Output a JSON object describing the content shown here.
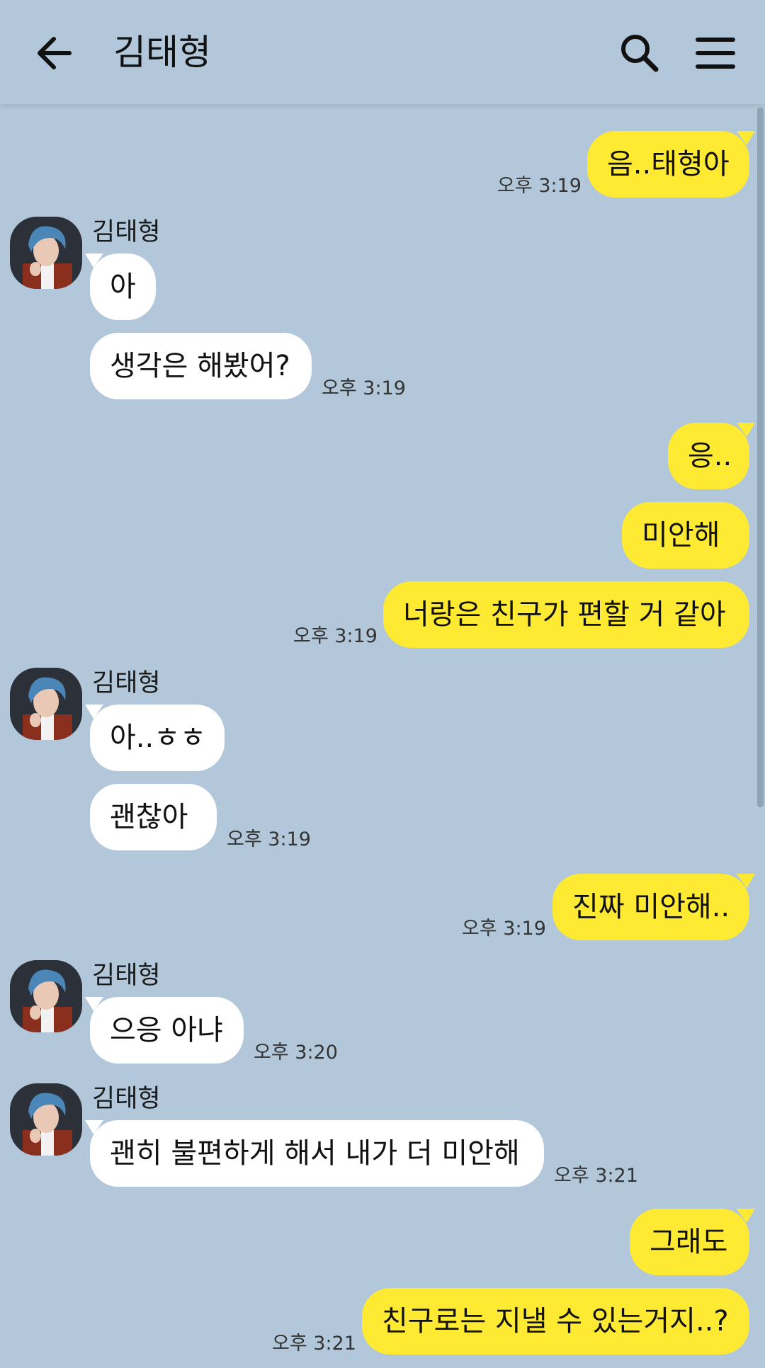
{
  "header": {
    "title": "김태형",
    "back_icon": "arrow-left-icon",
    "search_icon": "search-icon",
    "menu_icon": "hamburger-menu-icon"
  },
  "colors": {
    "background": "#b2c7d9",
    "my_bubble": "#fee933",
    "other_bubble": "#ffffff"
  },
  "messages": [
    {
      "from": "me",
      "text": "음..태형아",
      "time": "오후 3:19"
    },
    {
      "from": "other",
      "sender": "김태형",
      "text": "아"
    },
    {
      "from": "other",
      "text": "생각은 해봤어?",
      "time": "오후 3:19"
    },
    {
      "from": "me",
      "text": "응.."
    },
    {
      "from": "me",
      "text": "미안해"
    },
    {
      "from": "me",
      "text": "너랑은 친구가 편할 거 같아",
      "time": "오후 3:19"
    },
    {
      "from": "other",
      "sender": "김태형",
      "text": "아..ㅎㅎ"
    },
    {
      "from": "other",
      "text": "괜찮아",
      "time": "오후 3:19"
    },
    {
      "from": "me",
      "text": "진짜 미안해..",
      "time": "오후 3:19"
    },
    {
      "from": "other",
      "sender": "김태형",
      "text": "으응 아냐",
      "time": "오후 3:20"
    },
    {
      "from": "other",
      "sender": "김태형",
      "text": "괜히 불편하게 해서 내가 더 미안해",
      "time": "오후 3:21"
    },
    {
      "from": "me",
      "text": "그래도"
    },
    {
      "from": "me",
      "text": "친구로는 지낼 수 있는거지..?",
      "time": "오후 3:21"
    }
  ]
}
